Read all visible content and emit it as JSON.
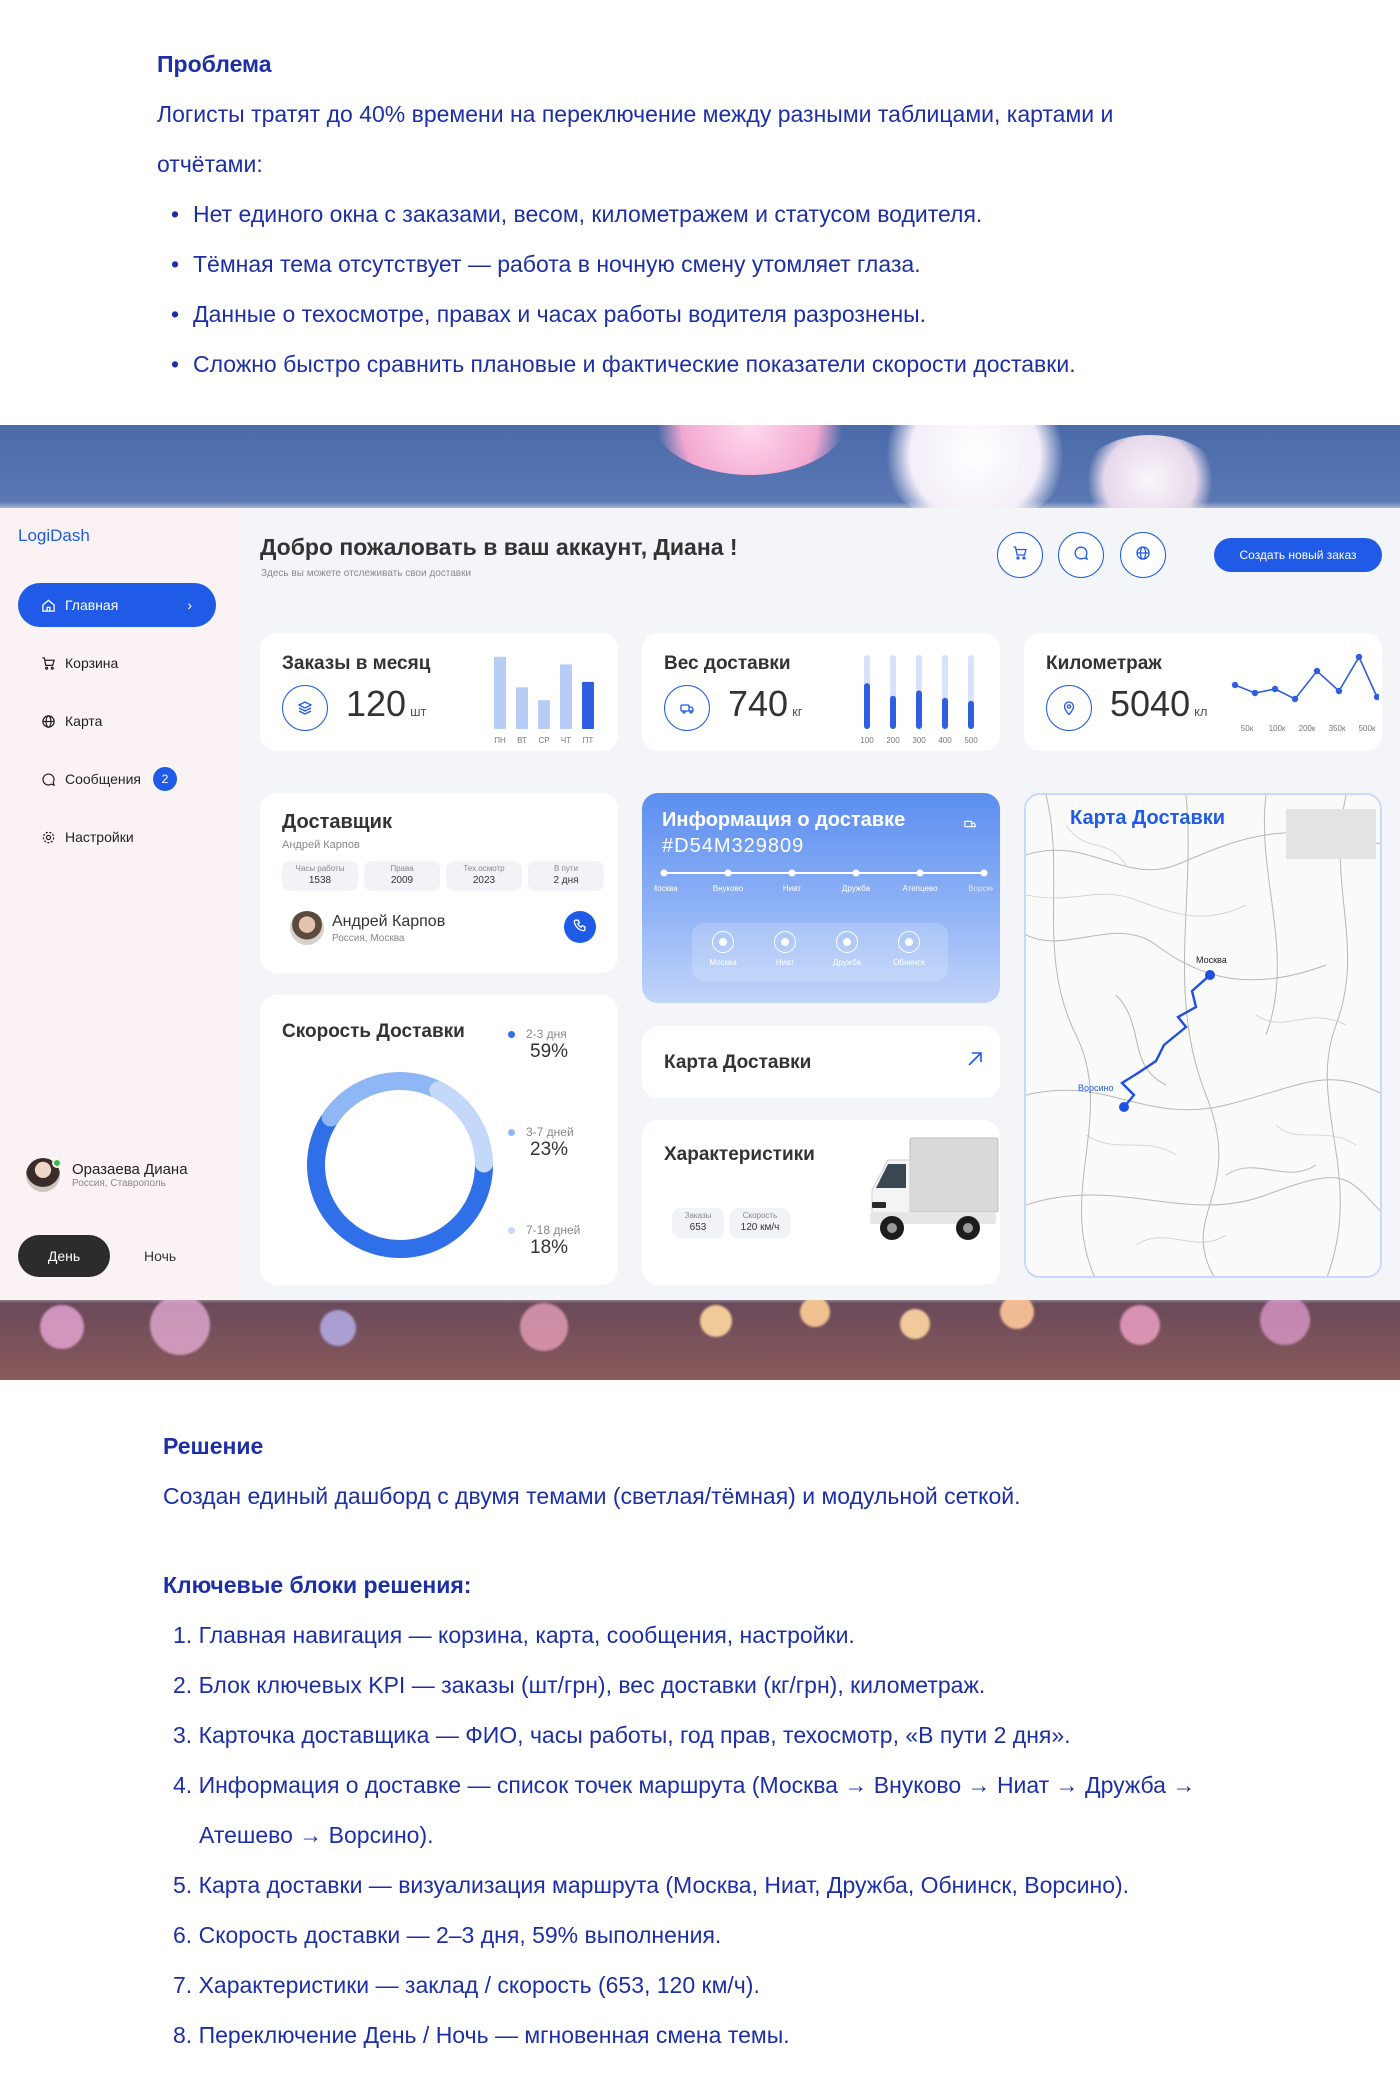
{
  "problem": {
    "title": "Проблема",
    "para_line1": "Логисты тратят до 40% времени на переключение между разными таблицами, картами и",
    "para_line2": "отчётами:",
    "bullets": [
      "Нет единого окна с заказами, весом, километражем и статусом водителя.",
      "Тёмная тема отсутствует — работа в ночную смену утомляет глаза.",
      "Данные о техосмотре, правах и часах работы водителя разрознены.",
      "Сложно быстро сравнить плановые и фактические показатели скорости доставки."
    ]
  },
  "app": {
    "brand": "LogiDash",
    "nav": [
      {
        "label": "Главная",
        "icon": "home-icon"
      },
      {
        "label": "Корзина",
        "icon": "cart-icon"
      },
      {
        "label": "Карта",
        "icon": "globe-icon"
      },
      {
        "label": "Сообщения",
        "icon": "chat-icon",
        "badge": "2"
      },
      {
        "label": "Настройки",
        "icon": "gear-icon"
      }
    ],
    "nav_chevron": "›",
    "profile": {
      "name": "Оразаева Диана",
      "location": "Россия, Ставрополь"
    },
    "theme": {
      "day": "День",
      "night": "Ночь"
    },
    "header": {
      "title": "Добро пожаловать в ваш аккаунт, Диана !",
      "subtitle": "Здесь вы можете отслеживать свои доставки",
      "create_button": "Создать новый заказ"
    },
    "kpi": {
      "orders": {
        "label": "Заказы в месяц",
        "value": "120",
        "unit": "шт",
        "bar_days": [
          "ПН",
          "ВТ",
          "СР",
          "ЧТ",
          "ПТ"
        ],
        "bar_values": [
          0.95,
          0.55,
          0.38,
          0.85,
          0.62
        ]
      },
      "weight": {
        "label": "Вес доставки",
        "value": "740",
        "unit": "кг",
        "bar_ticks": [
          "100",
          "200",
          "300",
          "400",
          "500"
        ]
      },
      "mileage": {
        "label": "Километраж",
        "value": "5040",
        "unit": "кл",
        "ticks": [
          "50к",
          "100к",
          "200к",
          "350к",
          "500к"
        ]
      }
    },
    "courier": {
      "title": "Доставщик",
      "subtitle": "Андрей Карпов",
      "stats": [
        {
          "label": "Часы работы",
          "value": "1538"
        },
        {
          "label": "Права",
          "value": "2009"
        },
        {
          "label": "Тех.осмотр",
          "value": "2023"
        },
        {
          "label": "В пути",
          "value": "2 дня"
        }
      ],
      "name": "Андрей Карпов",
      "location": "Россия, Москва"
    },
    "delivery_info": {
      "title": "Информация о доставке",
      "code": "#D54M329809",
      "route": [
        "Москва",
        "Внуково",
        "Ниат",
        "Дружба",
        "Атепцево",
        "Ворсино"
      ],
      "stops": [
        "Москва",
        "Ниат",
        "Дружба",
        "Обнинск"
      ]
    },
    "map_link": {
      "label": "Карта Доставки"
    },
    "speed": {
      "title": "Скорость Доставки",
      "legend": [
        {
          "label": "2-3 дня",
          "value": "59%",
          "color": "#2f6fe8"
        },
        {
          "label": "3-7 дней",
          "value": "23%",
          "color": "#8fb6f5"
        },
        {
          "label": "7-18 дней",
          "value": "18%",
          "color": "#c4d8fa"
        }
      ]
    },
    "specs": {
      "title": "Характеристики",
      "stats": [
        {
          "label": "Заказы",
          "value": "653"
        },
        {
          "label": "Скорость",
          "value": "120 км/ч"
        }
      ]
    },
    "map": {
      "title": "Карта Доставки",
      "labels": [
        "Москва",
        "Ворсино"
      ]
    }
  },
  "solution": {
    "title": "Решение",
    "para": "Создан единый дашборд с двумя темами (светлая/тёмная) и модульной сеткой.",
    "blocks_title": "Ключевые блоки решения:",
    "items": [
      "Главная навигация — корзина, карта, сообщения, настройки.",
      "Блок ключевых KPI — заказы (шт/грн), вес доставки (кг/грн), километраж.",
      "Карточка доставщика — ФИО, часы работы, год прав, техосмотр, «В пути 2 дня».",
      "Информация о доставке — список точек маршрута (Москва → Внуково → Ниат → Дружба →",
      "Атешево → Ворсино).",
      "Карта доставки — визуализация маршрута (Москва, Ниат, Дружба, Обнинск, Ворсино).",
      "Скорость доставки — 2–3 дня, 59% выполнения.",
      "Характеристики — заклад / скорость (653, 120 км/ч).",
      "Переключение День / Ночь — мгновенная смена темы."
    ],
    "numbers": [
      "1.",
      "2.",
      "3.",
      "4.",
      "5.",
      "6.",
      "7.",
      "8."
    ]
  }
}
